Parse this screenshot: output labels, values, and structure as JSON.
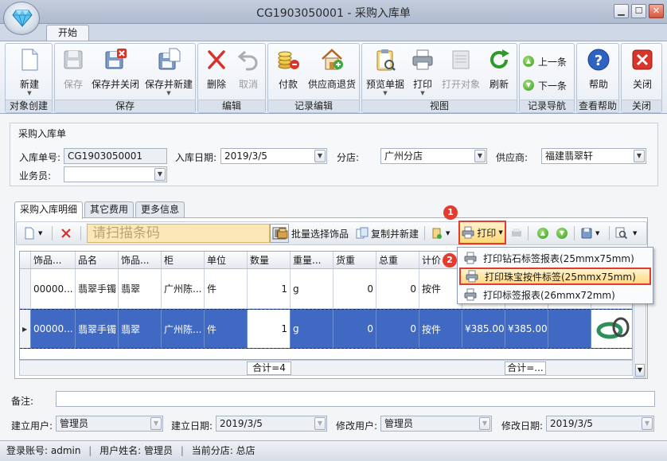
{
  "window": {
    "title": "CG1903050001 - 采购入库单"
  },
  "ribbon": {
    "tab": "开始",
    "groups": {
      "create": {
        "label": "对象创建",
        "new": "新建"
      },
      "save": {
        "label": "保存",
        "save": "保存",
        "save_close": "保存并关闭",
        "save_new": "保存并新建"
      },
      "edit": {
        "label": "编辑",
        "delete": "删除",
        "cancel": "取消"
      },
      "record_edit": {
        "label": "记录编辑",
        "pay": "付款",
        "supplier_return": "供应商退货"
      },
      "view": {
        "label": "视图",
        "preview": "预览单据",
        "print": "打印",
        "print_object": "打开对象",
        "refresh": "刷新"
      },
      "nav": {
        "label": "记录导航",
        "prev": "上一条",
        "next": "下一条"
      },
      "help": {
        "label": "查看帮助",
        "help": "帮助"
      },
      "close": {
        "label": "关闭",
        "close": "关闭"
      }
    }
  },
  "form": {
    "title": "采购入库单",
    "order_no_label": "入库单号:",
    "order_no": "CG1903050001",
    "date_label": "入库日期:",
    "date": "2019/3/5",
    "branch_label": "分店:",
    "branch": "广州分店",
    "supplier_label": "供应商:",
    "supplier": "福建翡翠轩",
    "clerk_label": "业务员:",
    "clerk": ""
  },
  "tabs": [
    "采购入库明细",
    "其它费用",
    "更多信息"
  ],
  "toolbar": {
    "scan_placeholder": "请扫描条码",
    "batch_select": "批量选择饰品",
    "copy_new": "复制并新建",
    "print": "打印"
  },
  "print_menu": {
    "items": [
      "打印钻石标签报表(25mmx75mm)",
      "打印珠宝按件标签(25mmx75mm)",
      "打印标签报表(26mmx72mm)"
    ]
  },
  "badges": [
    "1",
    "2"
  ],
  "grid": {
    "columns": [
      "饰品...",
      "品名",
      "饰品...",
      "柜",
      "单位",
      "数量",
      "重量...",
      "货重",
      "总重",
      "计价",
      "",
      "",
      "",
      ""
    ],
    "rows": [
      [
        "00000...",
        "翡翠手镯",
        "翡翠",
        "广州陈...",
        "件",
        "1",
        "g",
        "0",
        "0",
        "按件",
        "",
        "",
        "",
        ""
      ],
      [
        "00000...",
        "翡翠手镯",
        "翡翠",
        "广州陈...",
        "件",
        "1",
        "g",
        "0",
        "0",
        "按件",
        "¥385.00",
        "¥385.00",
        "",
        ""
      ]
    ],
    "sum_count": "合计=4",
    "sum_other": "合计=..."
  },
  "bottom": {
    "remark_label": "备注:",
    "remark": "",
    "creator_label": "建立用户:",
    "creator": "管理员",
    "create_date_label": "建立日期:",
    "create_date": "2019/3/5",
    "modifier_label": "修改用户:",
    "modifier": "管理员",
    "modify_date_label": "修改日期:",
    "modify_date": "2019/3/5"
  },
  "status": {
    "account": "登录账号: admin",
    "username": "用户姓名: 管理员",
    "branch": "当前分店: 总店"
  },
  "colors": {
    "accent_red": "#e33b2e",
    "selection_blue": "#3f69c2",
    "highlight_yellow": "#ffd978"
  }
}
